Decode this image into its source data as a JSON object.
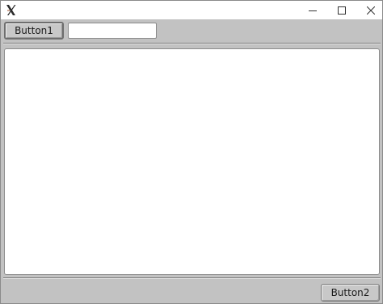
{
  "window": {
    "icon": "x-app-icon",
    "controls": {
      "minimize_icon": "minimize-icon",
      "maximize_icon": "maximize-icon",
      "close_icon": "close-icon"
    }
  },
  "toolbar": {
    "button1_label": "Button1",
    "text_input_value": "",
    "text_input_placeholder": ""
  },
  "content": {
    "text": ""
  },
  "footer": {
    "button2_label": "Button2"
  },
  "colors": {
    "window_background": "#c2c2c2",
    "titlebar_background": "#ffffff",
    "content_background": "#ffffff",
    "button_background": "#c8c8c8"
  }
}
